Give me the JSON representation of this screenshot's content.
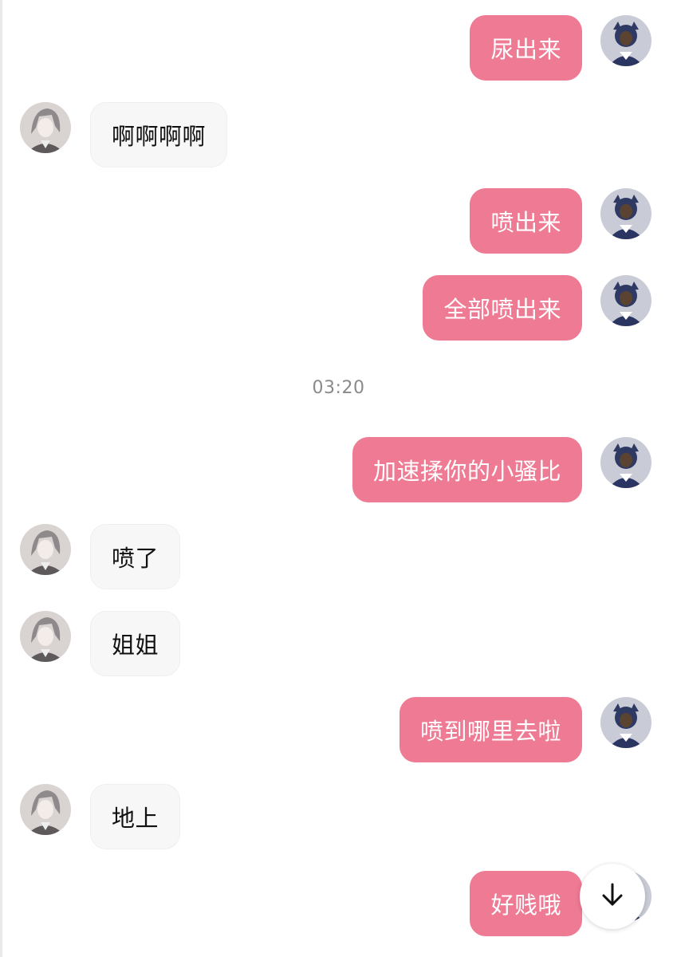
{
  "chat": {
    "timestamp": "03:20",
    "messages": [
      {
        "sender": "me",
        "text": "尿出来"
      },
      {
        "sender": "other",
        "text": "啊啊啊啊"
      },
      {
        "sender": "me",
        "text": "喷出来"
      },
      {
        "sender": "me",
        "text": "全部喷出来"
      },
      {
        "sender": "me",
        "text": "加速揉你的小骚比"
      },
      {
        "sender": "other",
        "text": "喷了"
      },
      {
        "sender": "other",
        "text": "姐姐"
      },
      {
        "sender": "me",
        "text": "喷到哪里去啦"
      },
      {
        "sender": "other",
        "text": "地上"
      },
      {
        "sender": "me",
        "text": "好贱哦"
      }
    ]
  },
  "colors": {
    "outgoing_bubble": "#ee7a93",
    "incoming_bubble": "#f7f7f7",
    "timestamp_text": "#8a8a8a"
  },
  "icons": {
    "scroll_to_bottom": "arrow-down-icon"
  }
}
